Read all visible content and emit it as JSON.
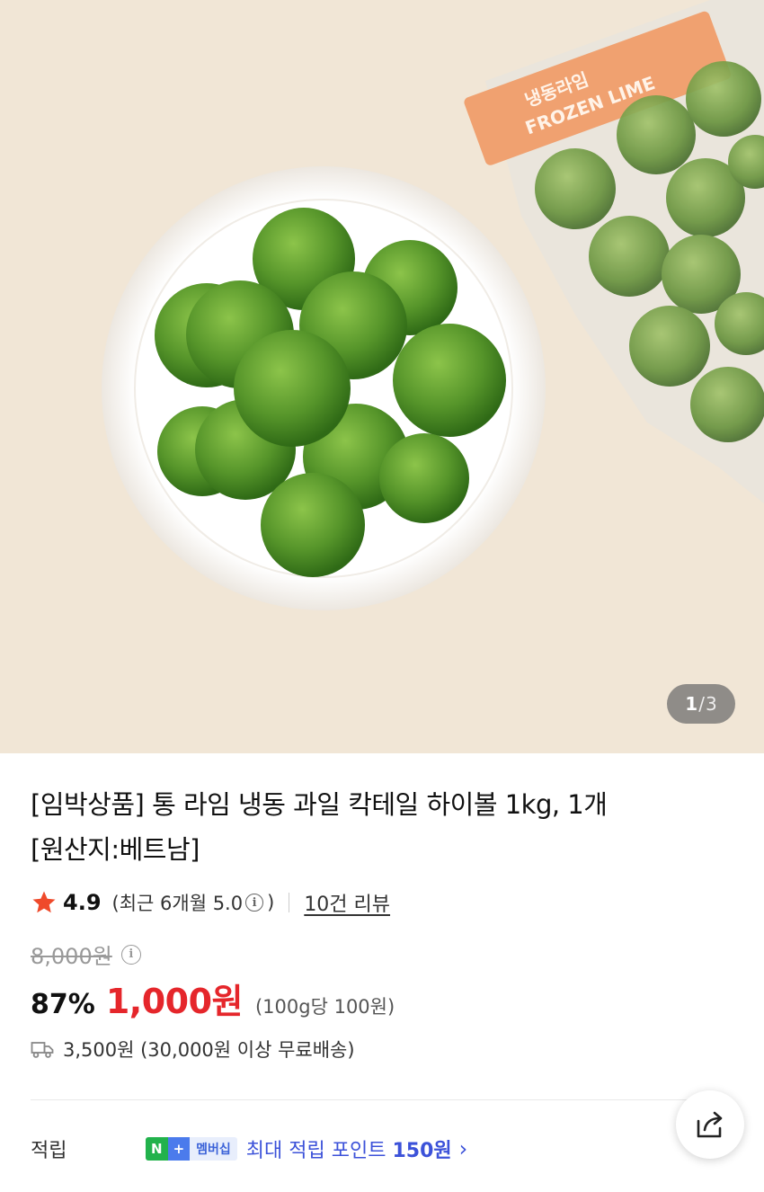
{
  "gallery": {
    "current": "1",
    "separator": "/",
    "total": "3",
    "package_label_kr": "냉동라임",
    "package_label_en": "FROZEN LIME"
  },
  "product": {
    "title_line1": "[임박상품] 통 라임 냉동 과일 칵테일 하이볼 1kg, 1개",
    "title_line2": "[원산지:베트남]"
  },
  "rating": {
    "value": "4.9",
    "recent_open": "(최근 6개월 5.0",
    "recent_close": ")",
    "review_link": "10건 리뷰"
  },
  "price": {
    "original": "8,000원",
    "discount": "87%",
    "sale": "1,000원",
    "unit": "(100g당 100원)"
  },
  "shipping": {
    "text": "3,500원 (30,000원 이상 무료배송)"
  },
  "points": {
    "label": "적립",
    "badge_n": "N",
    "badge_plus": "+",
    "badge_member": "멤버십",
    "text_prefix": "최대 적립 포인트 ",
    "text_amount": "150원"
  },
  "colors": {
    "sale_red": "#e5262b",
    "points_blue": "#3c52d9",
    "star_red": "#ef4a2b"
  }
}
